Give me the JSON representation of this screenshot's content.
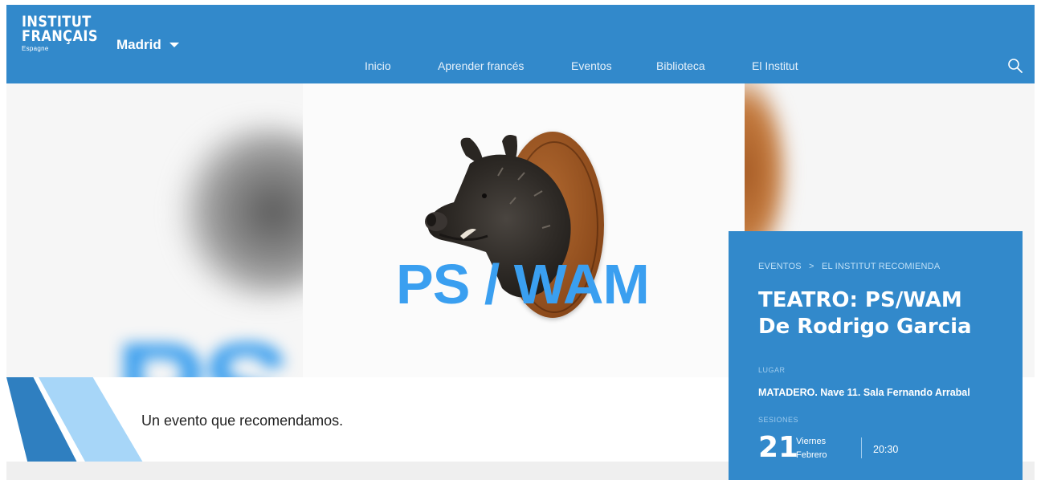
{
  "header": {
    "logo": {
      "line1": "INSTITUT",
      "line2": "FRANÇAIS",
      "line3": "Espagne"
    },
    "city": "Madrid",
    "nav": [
      "Inicio",
      "Aprender francés",
      "Eventos",
      "Biblioteca",
      "El Institut"
    ],
    "search_icon": "search-icon",
    "bg_color": "#3289cb"
  },
  "hero": {
    "title": "PS / WAM",
    "title_color": "#3a9ff0",
    "tagline": "Un evento que recomendamos."
  },
  "event": {
    "breadcrumb": [
      "EVENTOS",
      "EL INSTITUT RECOMIENDA"
    ],
    "breadcrumb_separator": ">",
    "title_line1": "TEATRO: PS/WAM",
    "title_line2": "De Rodrigo Garcia",
    "lugar_label": "LUGAR",
    "venue": "MATADERO. Nave 11. Sala Fernando Arrabal",
    "sesiones_label": "SESIONES",
    "session": {
      "day": "21",
      "weekday": "Viernes",
      "month": "Febrero",
      "time": "20:30"
    }
  }
}
